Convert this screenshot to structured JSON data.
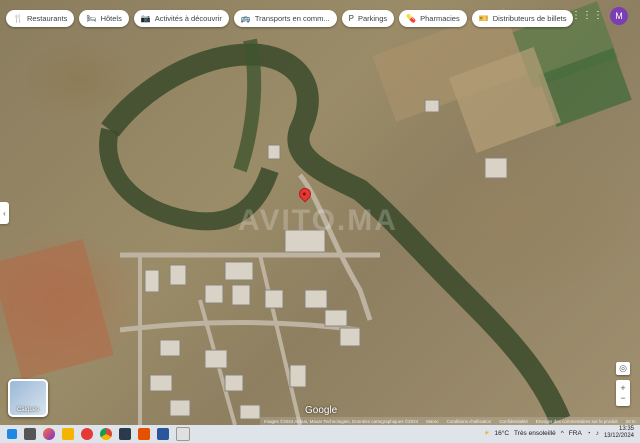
{
  "map": {
    "chips": [
      {
        "icon": "restaurant-icon",
        "glyph": "🍴",
        "label": "Restaurants"
      },
      {
        "icon": "hotel-icon",
        "glyph": "🛏",
        "label": "Hôtels"
      },
      {
        "icon": "camera-icon",
        "glyph": "📷",
        "label": "Activités à découvrir"
      },
      {
        "icon": "transit-icon",
        "glyph": "🚌",
        "label": "Transports en comm..."
      },
      {
        "icon": "parking-icon",
        "glyph": "P",
        "label": "Parkings"
      },
      {
        "icon": "pharmacy-icon",
        "glyph": "💊",
        "label": "Pharmacies"
      },
      {
        "icon": "ticket-icon",
        "glyph": "🎫",
        "label": "Distributeurs de billets"
      }
    ],
    "avatar_letter": "M",
    "layers_label": "Calques",
    "google_logo": "Google",
    "watermark": "AVITO.MA",
    "attribution": [
      "Images ©2024 Airbus, Maxar Technologies, Données cartographiques ©2024",
      "Maroc",
      "Conditions d'utilisation",
      "Confidentialité",
      "Envoyer des commentaires sur le produit",
      "20 m"
    ]
  },
  "taskbar": {
    "weather_temp": "16°C",
    "weather_text": "Très ensoleillé",
    "language": "FRA",
    "time": "13:35",
    "date": "13/12/2024"
  }
}
